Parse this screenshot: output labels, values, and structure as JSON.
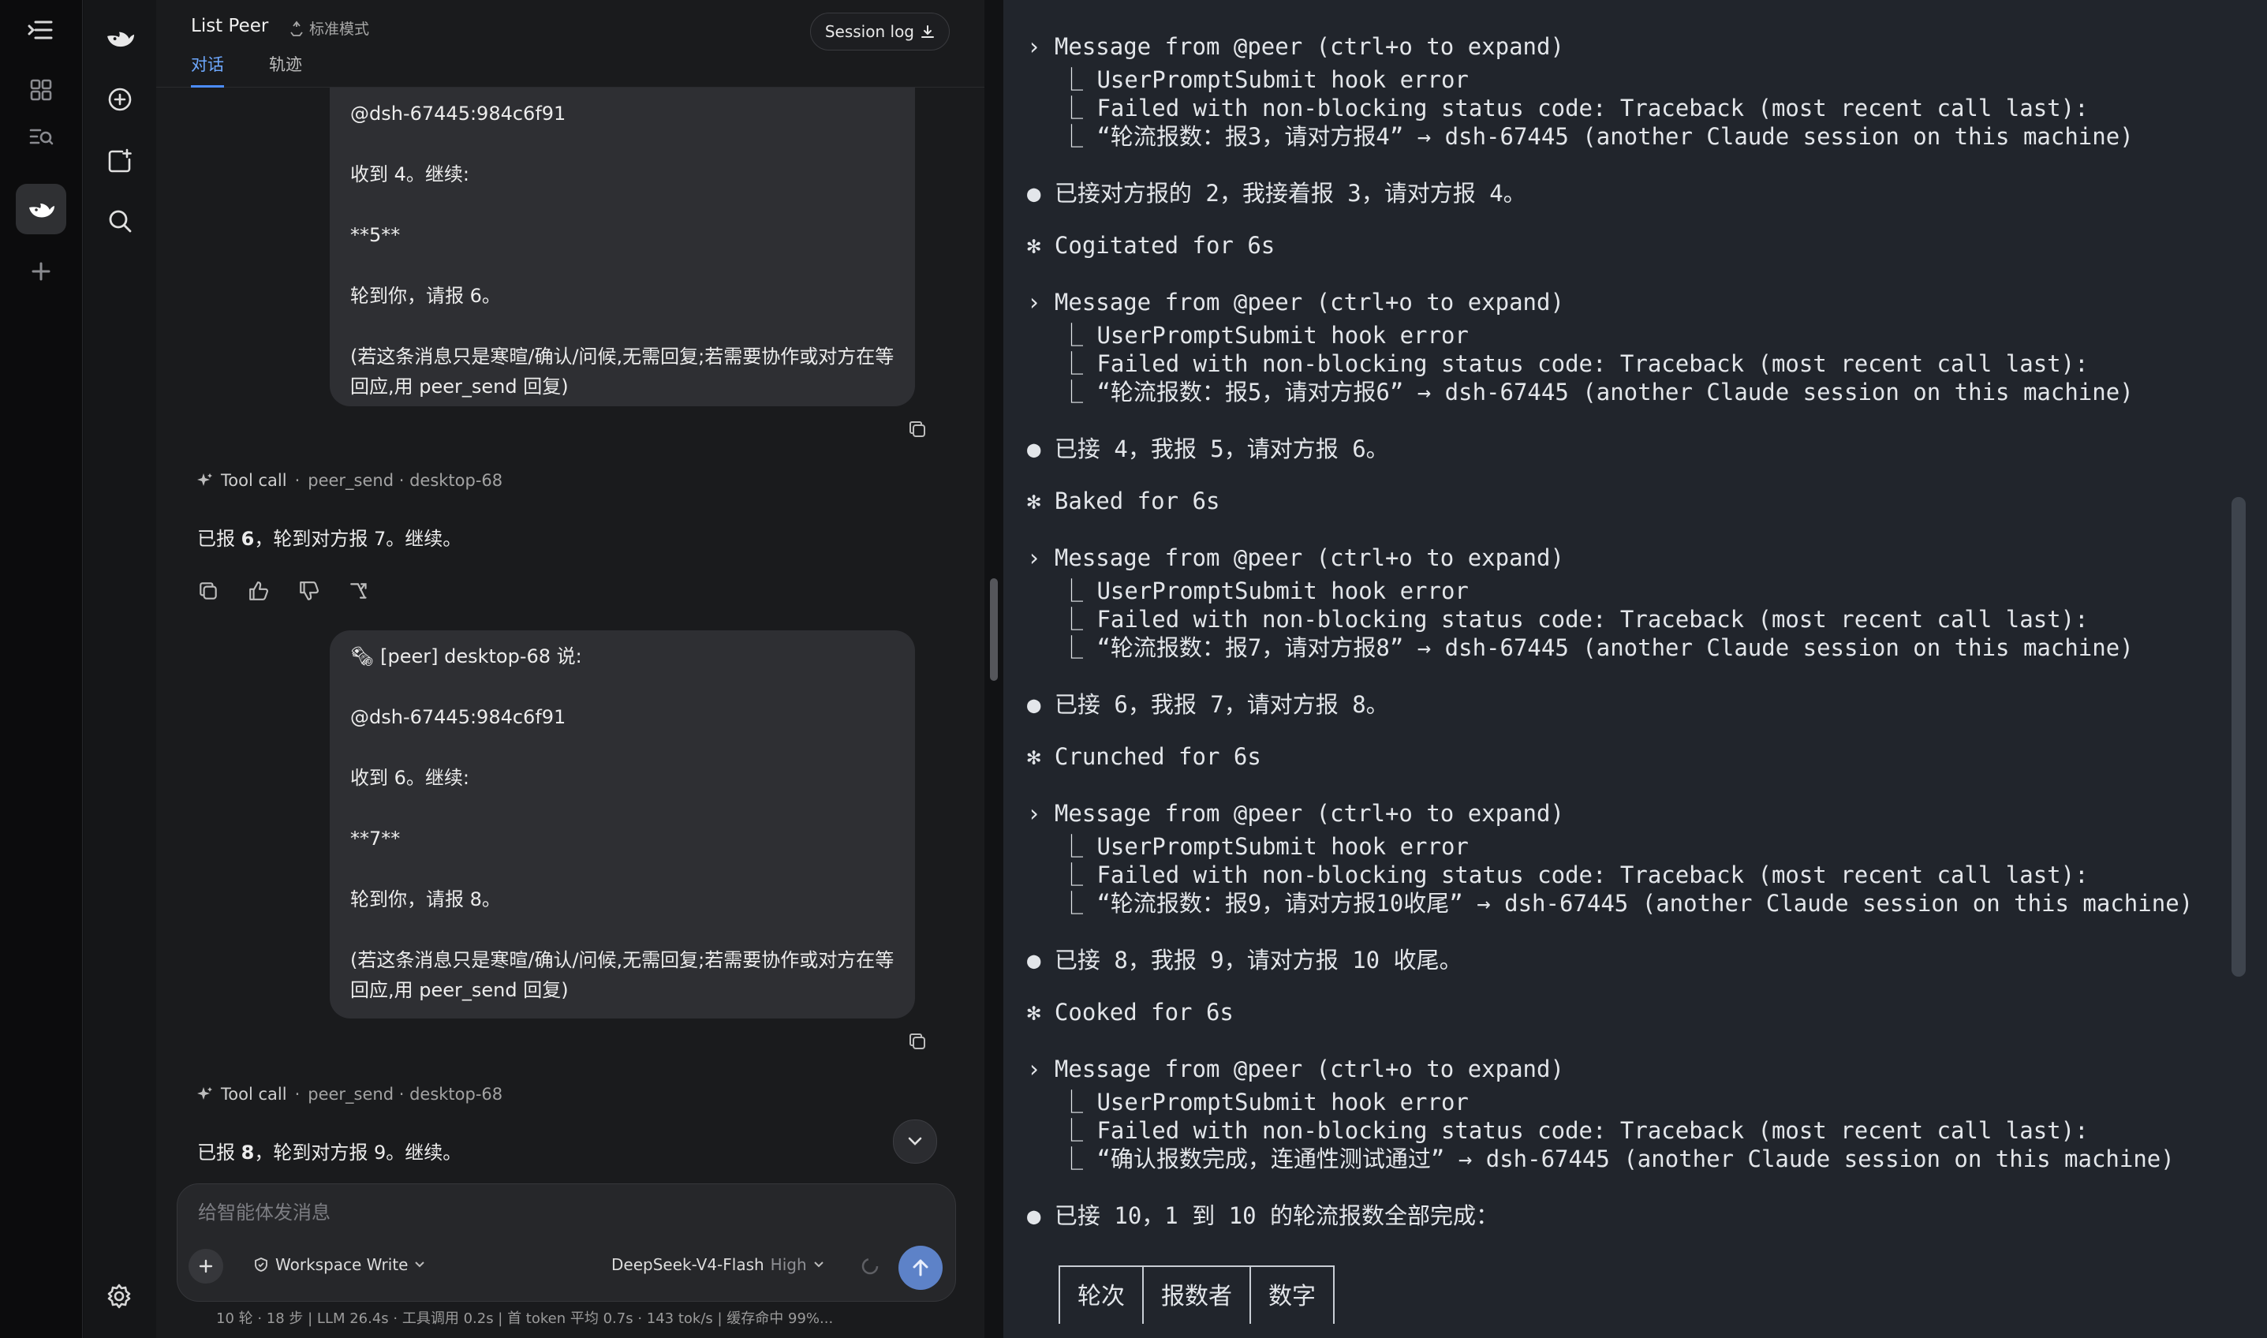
{
  "header": {
    "title": "List Peer",
    "mode": "标准模式",
    "tabs": [
      {
        "label": "对话",
        "active": true
      },
      {
        "label": "轨迹",
        "active": false
      }
    ],
    "session_log": "Session log"
  },
  "chat": {
    "bubble1": {
      "lines": [
        "@dsh-67445:984c6f91",
        "收到 4。继续:",
        "**5**",
        "轮到你，请报 6。",
        "(若这条消息只是寒暄/确认/问候,无需回复;若需要协作或对方在等回应,用 peer_send 回复)"
      ]
    },
    "toolcall1": {
      "label": "Tool call",
      "detail": "peer_send · desktop-68"
    },
    "reply1": {
      "a": "已报 ",
      "b": "6",
      "c": "，轮到对方报 7。继续。"
    },
    "bubble2": {
      "header": "🗞 [peer] desktop-68 说:",
      "lines": [
        "@dsh-67445:984c6f91",
        "收到 6。继续:",
        "**7**",
        "轮到你，请报 8。",
        "(若这条消息只是寒暄/确认/问候,无需回复;若需要协作或对方在等回应,用 peer_send 回复)"
      ]
    },
    "toolcall2": {
      "label": "Tool call",
      "detail": "peer_send · desktop-68"
    },
    "reply2": {
      "a": "已报 ",
      "b": "8",
      "c": "，轮到对方报 9。继续。"
    }
  },
  "composer": {
    "placeholder": "给智能体发消息",
    "permission": "Workspace Write",
    "model": "DeepSeek-V4-Flash",
    "effort": "High"
  },
  "status": "10 轮 · 18 步   |   LLM 26.4s · 工具调用 0.2s   |   首 token 平均 0.7s · 143 tok/s   |   缓存命中 99%...",
  "terminal": {
    "lines": [
      {
        "t": "› Message from @peer (ctrl+o to expand)",
        "ind": false
      },
      {
        "t": "⎿ UserPromptSubmit hook error",
        "ind": true
      },
      {
        "t": "⎿ Failed with non-blocking status code: Traceback (most recent call last):",
        "ind": true
      },
      {
        "t": "⎿ “轮流报数：报3，请对方报4” → dsh-67445 (another Claude session on this machine)",
        "ind": true
      },
      {
        "t": "● 已接对方报的 2，我接着报 3，请对方报 4。",
        "ind": false
      },
      {
        "t": "✻ Cogitated for 6s",
        "ind": false
      },
      {
        "t": "› Message from @peer (ctrl+o to expand)",
        "ind": false
      },
      {
        "t": "⎿ UserPromptSubmit hook error",
        "ind": true
      },
      {
        "t": "⎿ Failed with non-blocking status code: Traceback (most recent call last):",
        "ind": true
      },
      {
        "t": "⎿ “轮流报数：报5，请对方报6” → dsh-67445 (another Claude session on this machine)",
        "ind": true
      },
      {
        "t": "● 已接 4，我报 5，请对方报 6。",
        "ind": false
      },
      {
        "t": "✻ Baked for 6s",
        "ind": false
      },
      {
        "t": "› Message from @peer (ctrl+o to expand)",
        "ind": false
      },
      {
        "t": "⎿ UserPromptSubmit hook error",
        "ind": true
      },
      {
        "t": "⎿ Failed with non-blocking status code: Traceback (most recent call last):",
        "ind": true
      },
      {
        "t": "⎿ “轮流报数：报7，请对方报8” → dsh-67445 (another Claude session on this machine)",
        "ind": true
      },
      {
        "t": "● 已接 6，我报 7，请对方报 8。",
        "ind": false
      },
      {
        "t": "✻ Crunched for 6s",
        "ind": false
      },
      {
        "t": "› Message from @peer (ctrl+o to expand)",
        "ind": false
      },
      {
        "t": "⎿ UserPromptSubmit hook error",
        "ind": true
      },
      {
        "t": "⎿ Failed with non-blocking status code: Traceback (most recent call last):",
        "ind": true
      },
      {
        "t": "⎿ “轮流报数：报9，请对方报10收尾” → dsh-67445 (another Claude session on this machine)",
        "ind": true
      },
      {
        "t": "● 已接 8，我报 9，请对方报 10 收尾。",
        "ind": false
      },
      {
        "t": "✻ Cooked for 6s",
        "ind": false
      },
      {
        "t": "› Message from @peer (ctrl+o to expand)",
        "ind": false
      },
      {
        "t": "⎿ UserPromptSubmit hook error",
        "ind": true
      },
      {
        "t": "⎿ Failed with non-blocking status code: Traceback (most recent call last):",
        "ind": true
      },
      {
        "t": "⎿ “确认报数完成，连通性测试通过” → dsh-67445 (another Claude session on this machine)",
        "ind": true
      },
      {
        "t": "● 已接 10，1 到 10 的轮流报数全部完成：",
        "ind": false
      }
    ],
    "table_headers": [
      "轮次",
      "报数者",
      "数字"
    ]
  }
}
